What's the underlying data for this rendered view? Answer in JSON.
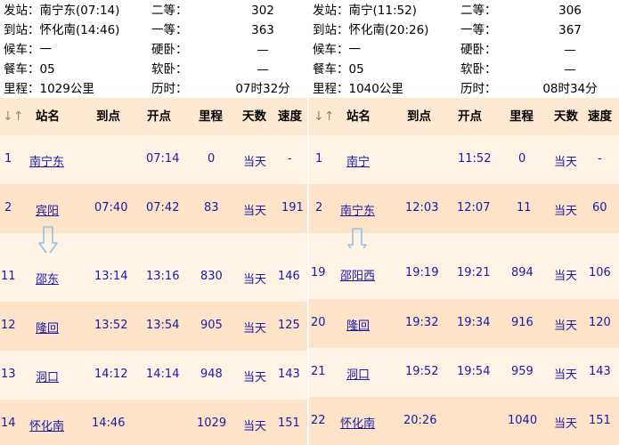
{
  "left": {
    "info": [
      {
        "k": "发站：南宁东(07:14)",
        "k2": "二等：",
        "v2": "302"
      },
      {
        "k": "到站：怀化南(14:46)",
        "k2": "一等：",
        "v2": "363"
      },
      {
        "k": "候车：一",
        "k2": "硬卧：",
        "v2": "—"
      },
      {
        "k": "餐车：05",
        "k2": "软卧：",
        "v2": "—"
      },
      {
        "k": "里程：1029公里",
        "k2": "历时：",
        "v2": "07时32分"
      }
    ],
    "headers": {
      "sort": "↓↑",
      "station": "站名",
      "arrive": "到点",
      "depart": "开点",
      "km": "里程",
      "day": "天数",
      "speed": "速度"
    },
    "rows": [
      {
        "no": "1",
        "station": "南宁东",
        "arrive": "",
        "depart": "07:14",
        "km": "0",
        "day": "当天",
        "speed": "-"
      },
      {
        "no": "2",
        "station": "宾阳",
        "arrive": "07:40",
        "depart": "07:42",
        "km": "83",
        "day": "当天",
        "speed": "191"
      },
      {
        "no": "11",
        "station": "邵东",
        "arrive": "13:14",
        "depart": "13:16",
        "km": "830",
        "day": "当天",
        "speed": "146"
      },
      {
        "no": "12",
        "station": "隆回",
        "arrive": "13:52",
        "depart": "13:54",
        "km": "905",
        "day": "当天",
        "speed": "125"
      },
      {
        "no": "13",
        "station": "洞口",
        "arrive": "14:12",
        "depart": "14:14",
        "km": "948",
        "day": "当天",
        "speed": "143"
      },
      {
        "no": "14",
        "station": "怀化南",
        "arrive": "14:46",
        "depart": "",
        "km": "1029",
        "day": "当天",
        "speed": "151"
      }
    ]
  },
  "right": {
    "info": [
      {
        "k": "发站：南宁(11:52)",
        "k2": "二等：",
        "v2": "306"
      },
      {
        "k": "到站：怀化南(20:26)",
        "k2": "一等：",
        "v2": "367"
      },
      {
        "k": "候车：一",
        "k2": "硬卧：",
        "v2": "—"
      },
      {
        "k": "餐车：05",
        "k2": "软卧：",
        "v2": "—"
      },
      {
        "k": "里程：1040公里",
        "k2": "历时：",
        "v2": "08时34分"
      }
    ],
    "headers": {
      "sort": "↓↑",
      "station": "站名",
      "arrive": "到点",
      "depart": "开点",
      "km": "里程",
      "day": "天数",
      "speed": "速度"
    },
    "rows": [
      {
        "no": "1",
        "station": "南宁",
        "arrive": "",
        "depart": "11:52",
        "km": "0",
        "day": "当天",
        "speed": "-"
      },
      {
        "no": "2",
        "station": "南宁东",
        "arrive": "12:03",
        "depart": "12:07",
        "km": "11",
        "day": "当天",
        "speed": "60"
      },
      {
        "no": "19",
        "station": "邵阳西",
        "arrive": "19:19",
        "depart": "19:21",
        "km": "894",
        "day": "当天",
        "speed": "106"
      },
      {
        "no": "20",
        "station": "隆回",
        "arrive": "19:32",
        "depart": "19:34",
        "km": "916",
        "day": "当天",
        "speed": "120"
      },
      {
        "no": "21",
        "station": "洞口",
        "arrive": "19:52",
        "depart": "19:54",
        "km": "959",
        "day": "当天",
        "speed": "143"
      },
      {
        "no": "22",
        "station": "怀化南",
        "arrive": "20:26",
        "depart": "",
        "km": "1040",
        "day": "当天",
        "speed": "151"
      }
    ]
  }
}
